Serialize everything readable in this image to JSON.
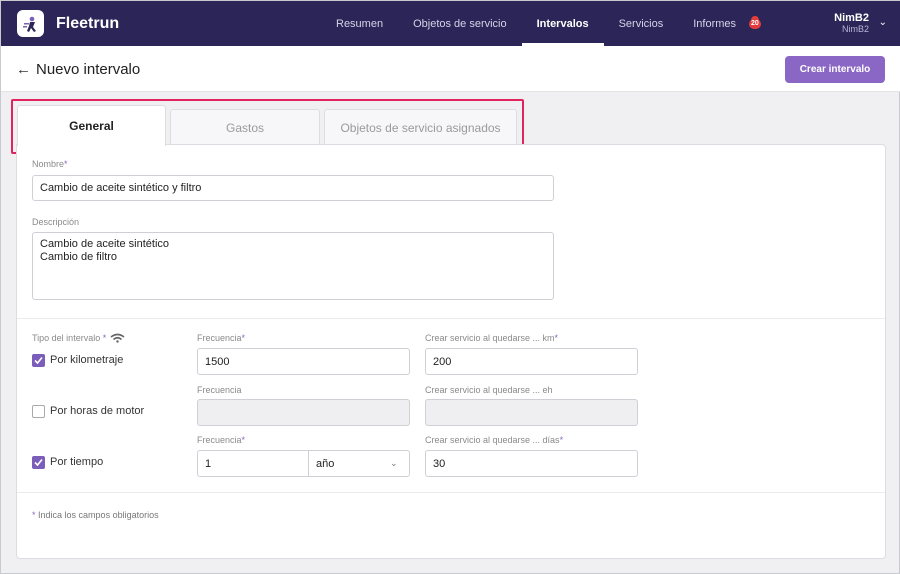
{
  "app": {
    "name": "Fleetrun"
  },
  "nav": {
    "items": [
      {
        "label": "Resumen",
        "active": false
      },
      {
        "label": "Objetos de servicio",
        "active": false
      },
      {
        "label": "Intervalos",
        "active": true
      },
      {
        "label": "Servicios",
        "active": false
      },
      {
        "label": "Informes",
        "active": false
      }
    ],
    "notification_count": "20"
  },
  "user": {
    "name": "NimB2",
    "account": "NimB2"
  },
  "header": {
    "title": "Nuevo intervalo",
    "create_button": "Crear intervalo"
  },
  "tabs": [
    {
      "label": "General",
      "active": true
    },
    {
      "label": "Gastos",
      "active": false
    },
    {
      "label": "Objetos de servicio asignados",
      "active": false
    }
  ],
  "form": {
    "name_label": "Nombre",
    "name_value": "Cambio de aceite sintético y filtro",
    "description_label": "Descripción",
    "description_value": "Cambio de aceite sintético\nCambio de filtro",
    "interval_type_label": "Tipo del intervalo",
    "required_mark": "*",
    "rows": [
      {
        "checkbox_label": "Por kilometraje",
        "checked": true,
        "frequency_label": "Frecuencia",
        "frequency_required": true,
        "frequency_value": "1500",
        "advance_label": "Crear servicio al quedarse ... km",
        "advance_required": true,
        "advance_value": "200"
      },
      {
        "checkbox_label": "Por horas de motor",
        "checked": false,
        "frequency_label": "Frecuencia",
        "frequency_required": false,
        "frequency_value": "",
        "advance_label": "Crear servicio al quedarse ... eh",
        "advance_required": false,
        "advance_value": ""
      },
      {
        "checkbox_label": "Por tiempo",
        "checked": true,
        "frequency_label": "Frecuencia",
        "frequency_required": true,
        "frequency_value": "1",
        "unit_value": "año",
        "advance_label": "Crear servicio al quedarse ... días",
        "advance_required": true,
        "advance_value": "30"
      }
    ],
    "footnote": "Indica los campos obligatorios"
  },
  "colors": {
    "topbar": "#2c2557",
    "accent": "#8a67c4",
    "highlight": "#e0245e"
  }
}
